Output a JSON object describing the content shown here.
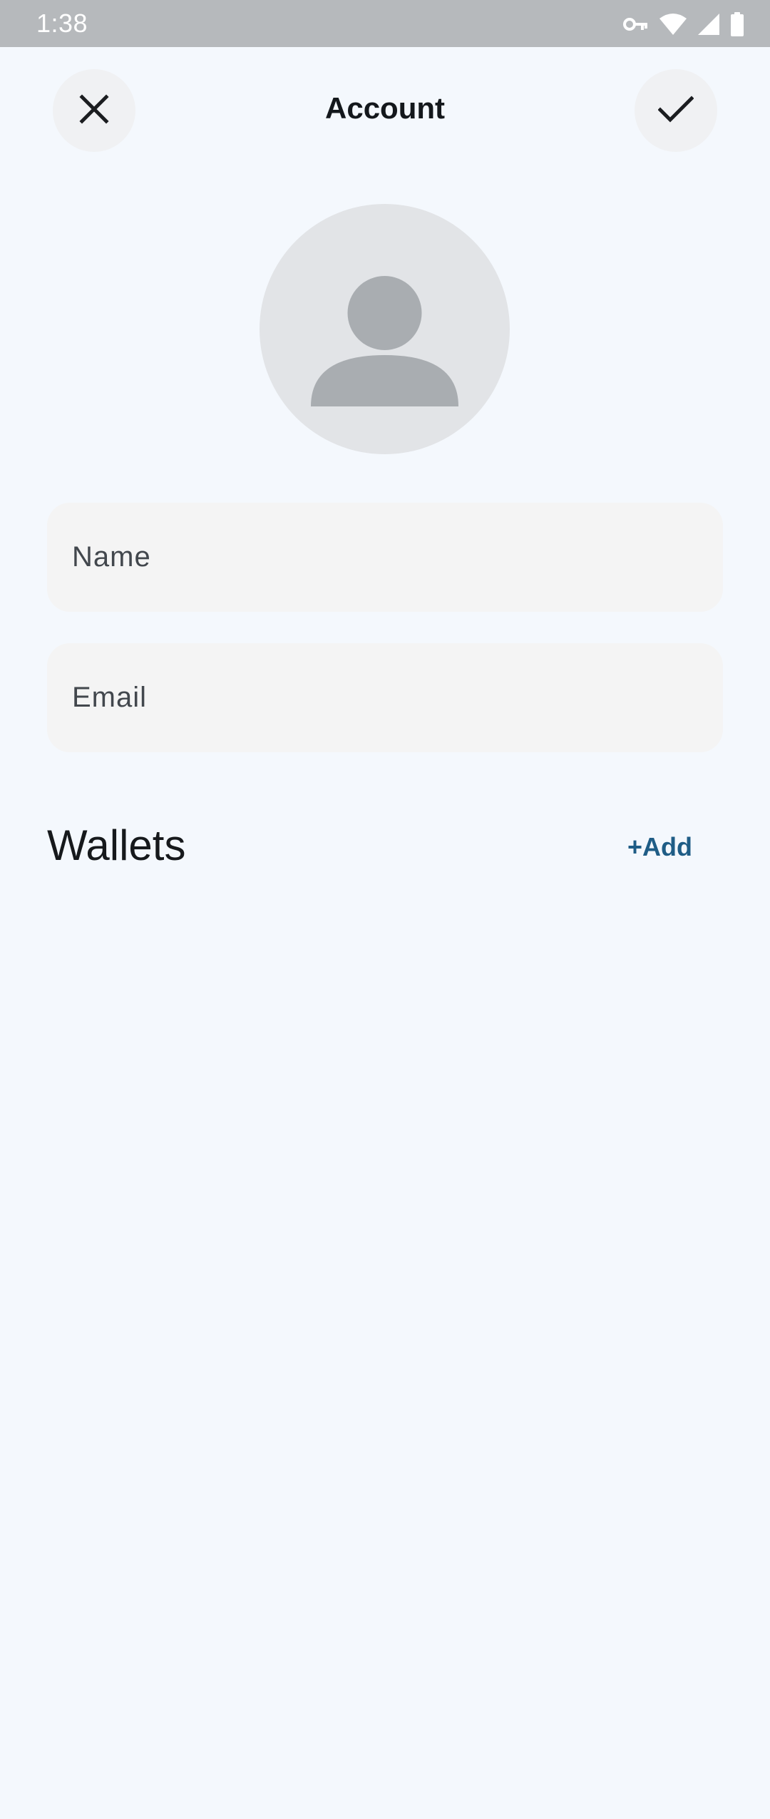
{
  "status_bar": {
    "time": "1:38",
    "icons": [
      "vpn-key-icon",
      "wifi-icon",
      "cell-signal-icon",
      "battery-icon"
    ]
  },
  "header": {
    "title": "Account",
    "close_icon": "close-icon",
    "confirm_icon": "check-icon"
  },
  "avatar": {
    "icon": "person-placeholder-icon"
  },
  "form": {
    "name_placeholder": "Name",
    "email_placeholder": "Email"
  },
  "wallets": {
    "title": "Wallets",
    "add_label": "+Add"
  },
  "colors": {
    "background": "#f4f8fd",
    "status_bar": "#b6b9bc",
    "accent": "#1f5d86",
    "field_bg": "#f4f4f4",
    "avatar_bg": "#e2e4e7",
    "avatar_figure": "#a9adb1"
  }
}
